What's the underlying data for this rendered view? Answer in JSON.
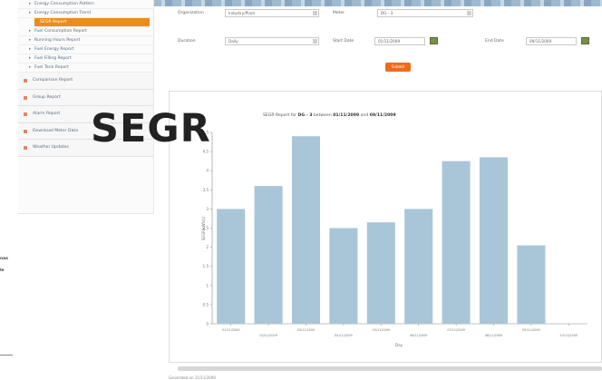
{
  "sidebar": {
    "sub_items": [
      {
        "label": "Energy Consumption Pattern",
        "active": false
      },
      {
        "label": "Energy Consumption Trend",
        "active": false
      },
      {
        "label": "SEGR Report",
        "active": true
      },
      {
        "label": "Fuel Consumption Report",
        "active": false
      },
      {
        "label": "Running Hours Report",
        "active": false
      },
      {
        "label": "Fuel Energy Report",
        "active": false
      },
      {
        "label": "Fuel Filling Report",
        "active": false
      },
      {
        "label": "Fuel Tank Report",
        "active": false
      }
    ],
    "main_items": [
      {
        "label": "Comparison Report"
      },
      {
        "label": "Group Report"
      },
      {
        "label": "Alarm Report"
      },
      {
        "label": "Download Meter Data"
      },
      {
        "label": "Weather Updates"
      }
    ]
  },
  "overlay_text": "SEGR",
  "left_notes": [
    "nas",
    "le"
  ],
  "form": {
    "organization_label": "Organization",
    "organization_value": "Industry/Plant",
    "meter_label": "Meter",
    "meter_value": "DG - 3",
    "duration_label": "Duration",
    "duration_value": "Daily",
    "start_label": "Start Date",
    "start_value": "01/11/2009",
    "end_label": "End Date",
    "end_value": "09/11/2009",
    "submit_label": "Submit"
  },
  "chart_title": {
    "prefix": "SEGR Report for",
    "meter": "DG - 3",
    "between": "between",
    "start": "01/11/2009",
    "and": "and",
    "end": "09/11/2009"
  },
  "chart_data": {
    "type": "bar",
    "categories": [
      "01/11/2009",
      "02/11/2009",
      "03/11/2009",
      "04/11/2009",
      "05/11/2009",
      "06/11/2009",
      "07/11/2009",
      "08/11/2009",
      "09/11/2009",
      "10/11/2009"
    ],
    "values": [
      3.0,
      3.6,
      4.9,
      2.5,
      2.65,
      3.0,
      4.25,
      4.35,
      2.05,
      0
    ],
    "ylim": [
      0,
      5
    ],
    "yticks": [
      "0",
      "0.5",
      "1",
      "1.5",
      "2",
      "2.5",
      "3",
      "3.5",
      "4",
      "4.5",
      "5"
    ],
    "ylabel": "SEGR(kWh/L)",
    "xlabel": "Day",
    "bar_color": "#a9c5d8"
  },
  "footer_text": "Generated on 11/11/2009"
}
